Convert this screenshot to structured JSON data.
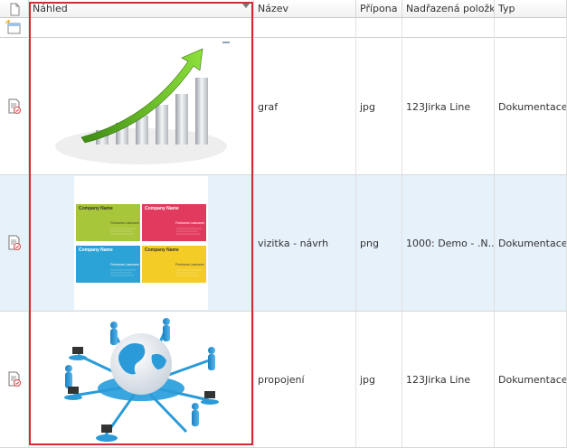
{
  "columns": {
    "preview": "Náhled",
    "name": "Název",
    "extension": "Přípona",
    "parent": "Nadřazená položka",
    "type": "Typ"
  },
  "rows": [
    {
      "name": "graf",
      "extension": "jpg",
      "parent": "123Jirka Line",
      "type": "Dokumentace",
      "preview": "growth-chart-image"
    },
    {
      "name": "vizitka - návrh",
      "extension": "png",
      "parent": "1000: Demo - .N...",
      "type": "Dokumentace",
      "preview": "business-cards-image",
      "card_text": {
        "company": "Company Name",
        "person": "Firstname Lastname"
      }
    },
    {
      "name": "propojení",
      "extension": "jpg",
      "parent": "123Jirka Line",
      "type": "Dokumentace",
      "preview": "network-globe-image"
    }
  ],
  "colors": {
    "highlight": "#d22b35",
    "alt_row": "#e6f1fa",
    "card_green": "#a8c63a",
    "card_red": "#e23a5e",
    "card_blue": "#2ba3d6",
    "card_yellow": "#f3cc25"
  }
}
